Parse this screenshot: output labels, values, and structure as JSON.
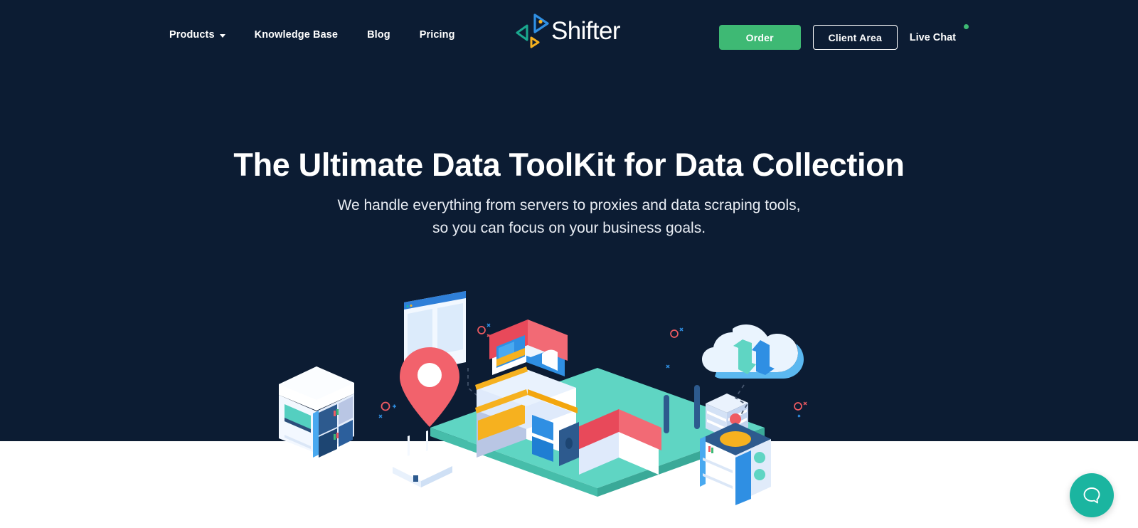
{
  "brand": {
    "name": "Shifter",
    "logo_icon": "shifter-triangles-logo",
    "colors": {
      "navy": "#0c1c33",
      "green": "#3eb974",
      "teal": "#1bb5a0",
      "blue": "#2f8fe3",
      "red": "#ef5b62",
      "yellow": "#f6b11f",
      "white": "#ffffff"
    }
  },
  "header": {
    "nav": [
      {
        "label": "Products",
        "has_dropdown": true,
        "icon": "chevron-down-icon"
      },
      {
        "label": "Knowledge Base",
        "has_dropdown": false
      },
      {
        "label": "Blog",
        "has_dropdown": false
      },
      {
        "label": "Pricing",
        "has_dropdown": false
      }
    ],
    "order_button": "Order",
    "client_area_button": "Client Area",
    "live_chat": "Live Chat",
    "live_chat_status": "online"
  },
  "hero": {
    "headline": "The Ultimate Data ToolKit for Data Collection",
    "subline_1": "We handle everything from servers to proxies and data scraping tools,",
    "subline_2": "so you can focus on your business goals."
  },
  "illustration": {
    "alt": "isometric data collection scene",
    "elements": [
      "server-tower",
      "browser-window",
      "wifi-router",
      "location-pin",
      "city-platform",
      "house-red-roof",
      "apartment-building",
      "cloud-sync",
      "data-server-box",
      "stacked-documents"
    ]
  },
  "chat_widget": {
    "icon": "chat-bubble-icon",
    "label": "Open live chat"
  }
}
